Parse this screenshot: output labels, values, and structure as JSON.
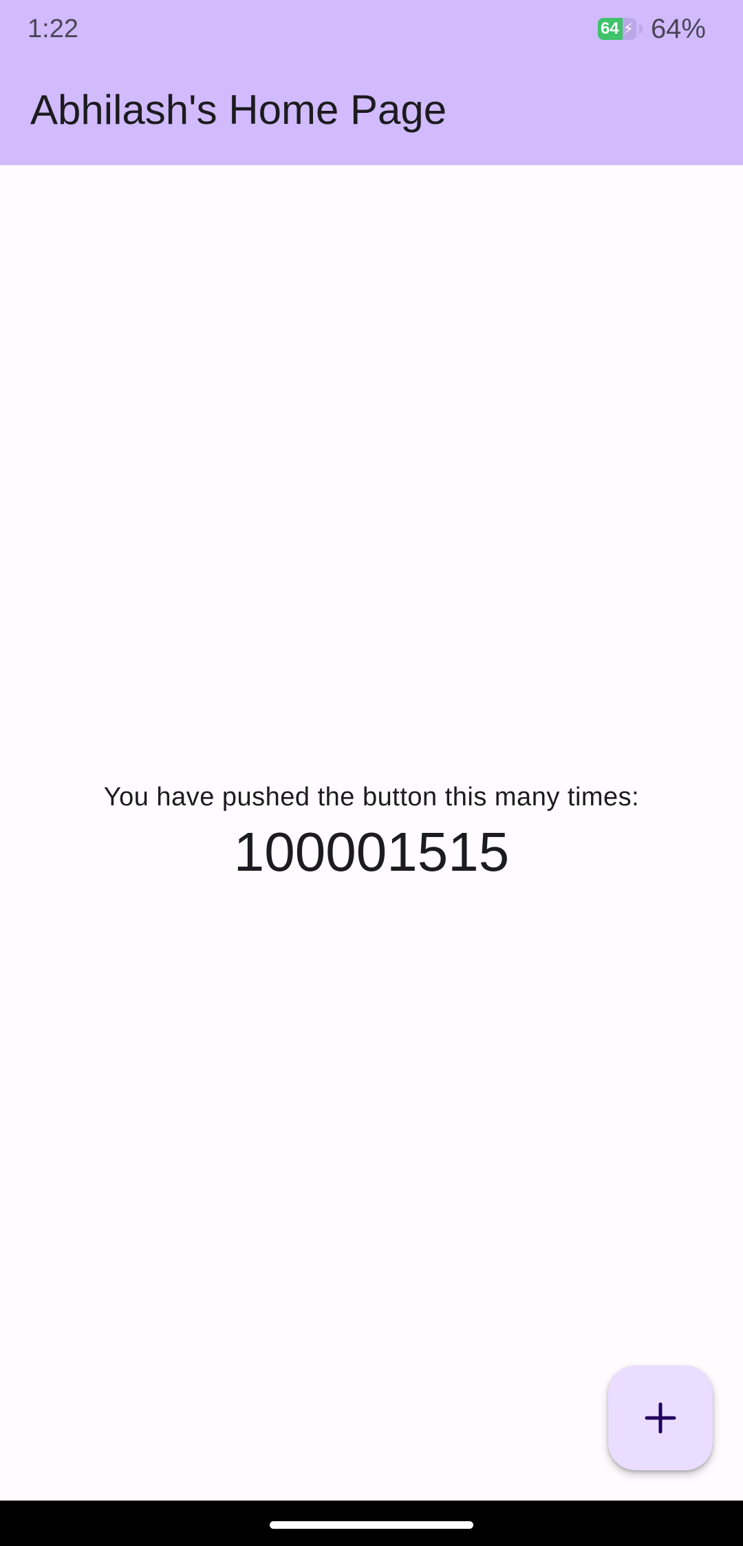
{
  "status_bar": {
    "time": "1:22",
    "battery_level_text": "64",
    "battery_percent_text": "64%",
    "battery_fraction": 0.64,
    "battery_icon": "battery-charging-icon"
  },
  "app_bar": {
    "title": "Abhilash's Home Page",
    "color": "#d1bbfc"
  },
  "main": {
    "counter_label": "You have pushed the button this many times:",
    "counter_value": "100001515"
  },
  "fab": {
    "icon": "plus-icon",
    "color": "#eaddff",
    "icon_color": "#21005d"
  },
  "navigation_bar": {
    "handle": "home-gesture-handle"
  }
}
